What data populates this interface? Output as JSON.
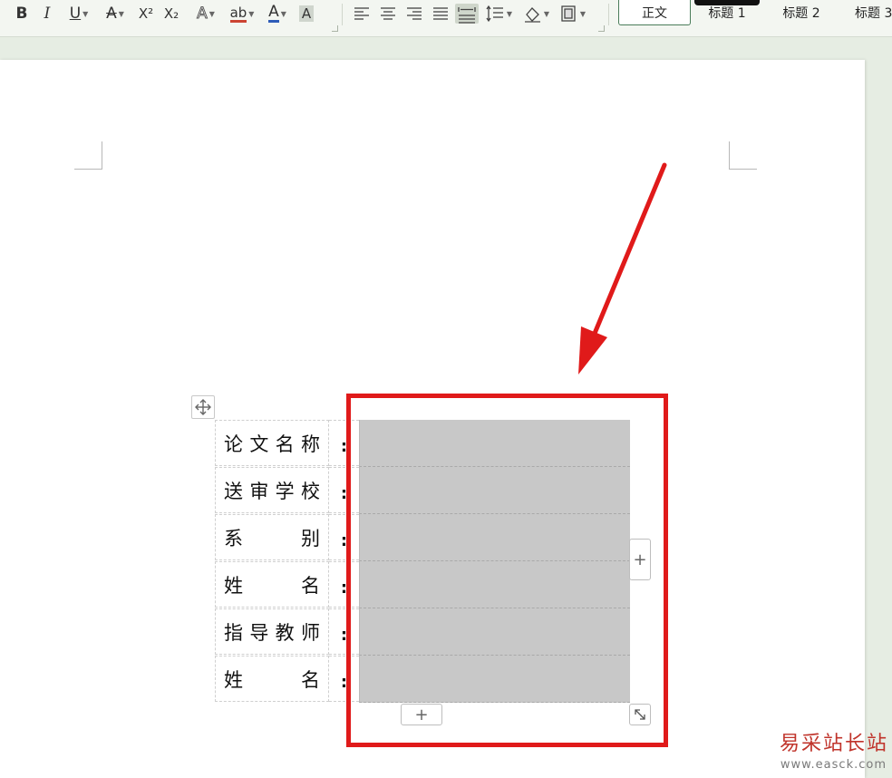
{
  "toolbar": {
    "format_buttons": [
      {
        "name": "bold-button",
        "label": "B"
      },
      {
        "name": "italic-button",
        "label": "I"
      },
      {
        "name": "underline-button",
        "label": "U"
      },
      {
        "name": "strikethrough-button",
        "label": "A"
      },
      {
        "name": "superscript-button",
        "label": "X²"
      },
      {
        "name": "subscript-button",
        "label": "X₂"
      },
      {
        "name": "text-effect-button",
        "label": "A"
      },
      {
        "name": "highlight-button",
        "label": "ab"
      },
      {
        "name": "font-color-button",
        "label": "A"
      },
      {
        "name": "char-shading-button",
        "label": "A"
      }
    ],
    "styles": [
      {
        "label": "正文",
        "active": true
      },
      {
        "label": "标题 1",
        "active": false
      },
      {
        "label": "标题 2",
        "active": false
      },
      {
        "label": "标题 3",
        "active": false
      }
    ],
    "accent_color": "#2e5cb8"
  },
  "table": {
    "rows": [
      {
        "label_chars": [
          "论",
          "文",
          "名",
          "称"
        ],
        "colon": ":",
        "value": ""
      },
      {
        "label_chars": [
          "送",
          "审",
          "学",
          "校"
        ],
        "colon": ":",
        "value": ""
      },
      {
        "label_chars": [
          "系",
          "别"
        ],
        "colon": ":",
        "value": ""
      },
      {
        "label_chars": [
          "姓",
          "名"
        ],
        "colon": ":",
        "value": ""
      },
      {
        "label_chars": [
          "指",
          "导",
          "教",
          "师"
        ],
        "colon": ":",
        "value": ""
      },
      {
        "label_chars": [
          "姓",
          "名"
        ],
        "colon": ":",
        "value": ""
      }
    ],
    "selection_color": "#c8c8c8",
    "add_label": "+"
  },
  "annotation": {
    "color": "#e01a1a"
  },
  "watermark": {
    "text": "易采站长站",
    "url": "www.easck.com"
  }
}
